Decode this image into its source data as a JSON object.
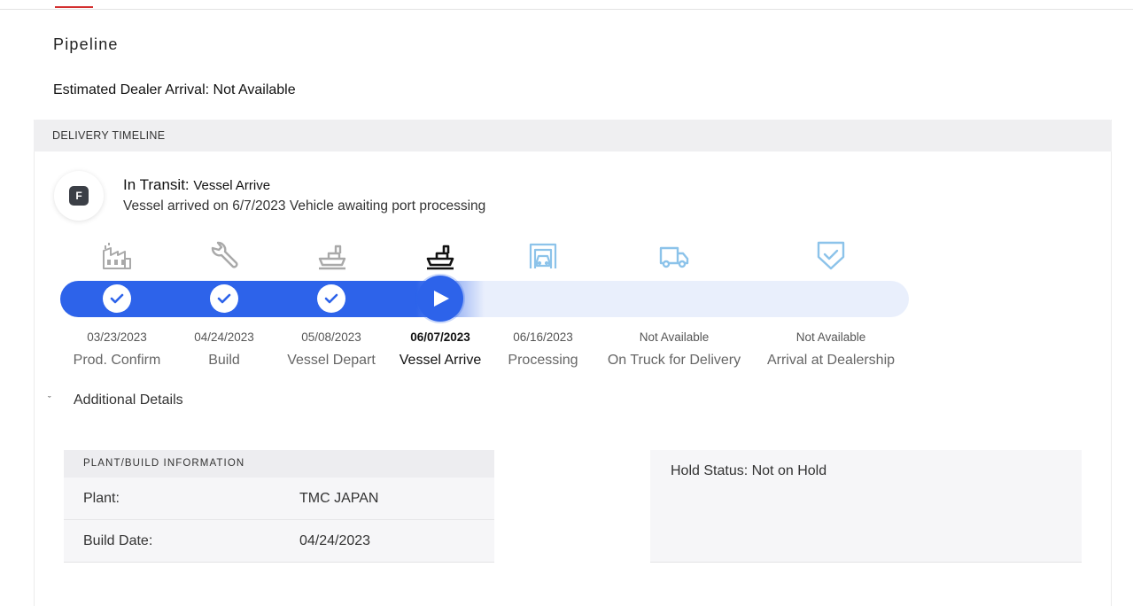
{
  "page": {
    "title": "Pipeline",
    "eta_label": "Estimated Dealer Arrival:",
    "eta_value": "Not Available"
  },
  "timeline": {
    "header": "DELIVERY TIMELINE",
    "badge_letter": "F",
    "status_title": "In Transit:",
    "status_subtitle": "Vessel Arrive",
    "status_detail": "Vessel arrived on 6/7/2023 Vehicle awaiting port processing",
    "progress_fraction": 0.5,
    "steps": [
      {
        "label": "Prod. Confirm",
        "date": "03/23/2023",
        "state": "done",
        "icon": "factory-icon"
      },
      {
        "label": "Build",
        "date": "04/24/2023",
        "state": "done",
        "icon": "wrench-icon"
      },
      {
        "label": "Vessel Depart",
        "date": "05/08/2023",
        "state": "done",
        "icon": "ship-icon"
      },
      {
        "label": "Vessel Arrive",
        "date": "06/07/2023",
        "state": "current",
        "icon": "ship-icon"
      },
      {
        "label": "Processing",
        "date": "06/16/2023",
        "state": "pending",
        "icon": "garage-icon"
      },
      {
        "label": "On Truck for Delivery",
        "date": "Not Available",
        "state": "pending",
        "icon": "truck-icon"
      },
      {
        "label": "Arrival at Dealership",
        "date": "Not Available",
        "state": "pending",
        "icon": "shield-check-icon"
      }
    ]
  },
  "details": {
    "toggle_label": "Additional Details",
    "expanded": true,
    "plant": {
      "header": "PLANT/BUILD INFORMATION",
      "rows": [
        {
          "key": "Plant:",
          "value": "TMC JAPAN"
        },
        {
          "key": "Build Date:",
          "value": "04/24/2023"
        }
      ]
    },
    "hold_status": "Hold Status: Not on Hold"
  },
  "colors": {
    "accent": "#2d63ea",
    "track_bg": "#e9effc",
    "done_icon": "#a9a9a9",
    "current_icon": "#111111",
    "pending_icon": "#8cc3ea",
    "tab_marker": "#d32f2f"
  }
}
